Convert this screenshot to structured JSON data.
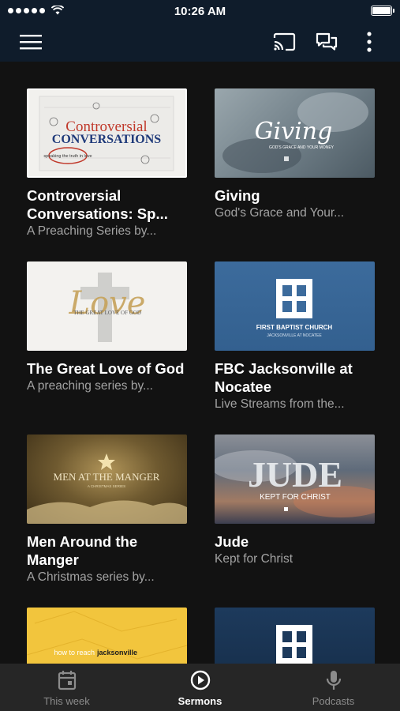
{
  "status": {
    "time": "10:26 AM"
  },
  "app_bar": {
    "menu_icon": "hamburger-menu-icon",
    "cast_icon": "cast-icon",
    "chat_icon": "chat-bubbles-icon",
    "more_icon": "more-vertical-icon"
  },
  "series": [
    {
      "title": "Controversial Conversations: Sp...",
      "subtitle": "A Preaching Series by...",
      "art": {
        "l1": "Controversial",
        "l2": "CONVERSATIONS",
        "l3": "speaking the truth in love"
      }
    },
    {
      "title": "Giving",
      "subtitle": "God's Grace and Your...",
      "art": {
        "l1": "Giving",
        "l2": "GOD'S GRACE AND YOUR MONEY"
      }
    },
    {
      "title": "The Great Love of God",
      "subtitle": "A preaching series by...",
      "art": {
        "l1": "Love",
        "l2": "THE GREAT LOVE OF GOD"
      }
    },
    {
      "title": "FBC Jacksonville at Nocatee",
      "subtitle": "Live Streams from the...",
      "art": {
        "l1": "FIRST BAPTIST CHURCH",
        "l2": "JACKSONVILLE AT NOCATEE"
      }
    },
    {
      "title": "Men Around the Manger",
      "subtitle": "A Christmas series by...",
      "art": {
        "l1": "MEN AT THE MANGER",
        "l2": "A CHRISTMAS SERIES"
      }
    },
    {
      "title": "Jude",
      "subtitle": "Kept for Christ",
      "art": {
        "l1": "JUDE",
        "l2": "KEPT FOR CHRIST"
      }
    },
    {
      "title": "",
      "subtitle": "",
      "art": {
        "l1": "how to reach",
        "l2": "jacksonville"
      }
    },
    {
      "title": "",
      "subtitle": "",
      "art": {}
    }
  ],
  "tabs": [
    {
      "label": "This week",
      "icon": "calendar-icon",
      "active": false
    },
    {
      "label": "Sermons",
      "icon": "play-circle-icon",
      "active": true
    },
    {
      "label": "Podcasts",
      "icon": "microphone-icon",
      "active": false
    }
  ],
  "colors": {
    "app_bar": "#0f1c2b",
    "background": "#121212",
    "tab_bar": "#262626",
    "subtitle": "#a3a3a3"
  }
}
